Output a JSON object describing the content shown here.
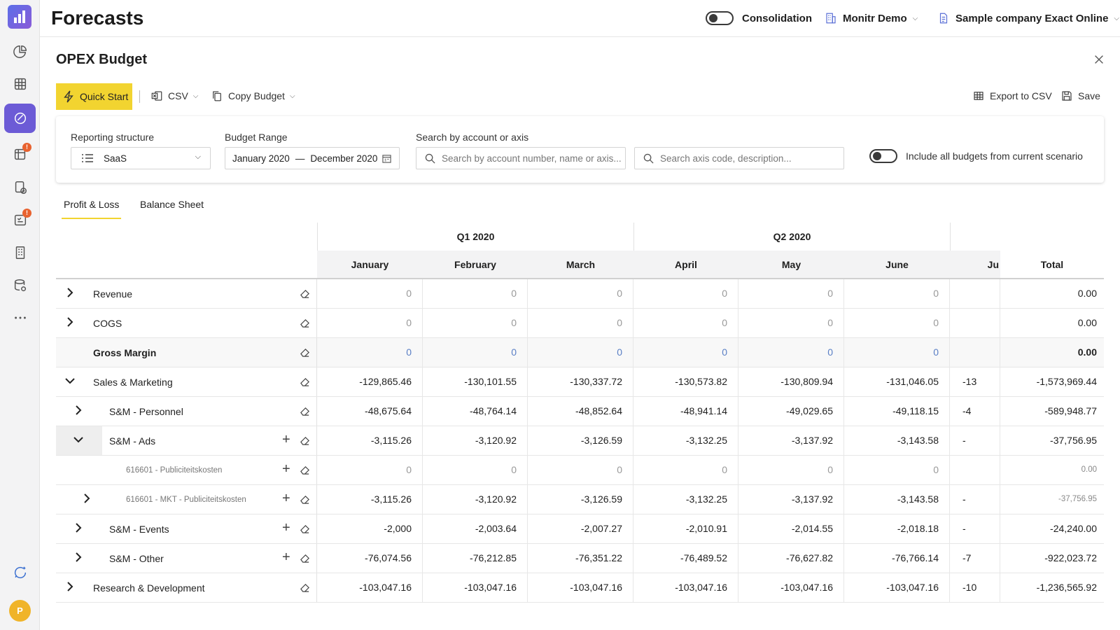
{
  "app": {
    "title": "Forecasts",
    "consolidation_label": "Consolidation",
    "org_name": "Monitr Demo",
    "company_name": "Sample company Exact Online",
    "avatar_initial": "P",
    "badge_count": "!"
  },
  "panel": {
    "title": "OPEX Budget",
    "toolbar": {
      "quick_start": "Quick Start",
      "csv": "CSV",
      "copy_budget": "Copy Budget",
      "export_csv": "Export to CSV",
      "save": "Save"
    },
    "filters": {
      "reporting_label": "Reporting structure",
      "reporting_value": "SaaS",
      "range_label": "Budget Range",
      "range_start": "January 2020",
      "range_sep": "—",
      "range_end": "December 2020",
      "search_label": "Search by account or axis",
      "search_account_placeholder": "Search by account number, name or axis...",
      "search_axis_placeholder": "Search axis code, description...",
      "include_label": "Include all budgets from current scenario"
    },
    "tabs": [
      "Profit & Loss",
      "Balance Sheet"
    ]
  },
  "grid": {
    "quarters": [
      "Q1 2020",
      "Q2 2020"
    ],
    "months": [
      "January",
      "February",
      "March",
      "April",
      "May",
      "June",
      "Ju"
    ],
    "total_label": "Total",
    "rows": [
      {
        "label": "Revenue",
        "values": [
          "0",
          "0",
          "0",
          "0",
          "0",
          "0"
        ],
        "partial": "",
        "total": "0.00"
      },
      {
        "label": "COGS",
        "values": [
          "0",
          "0",
          "0",
          "0",
          "0",
          "0"
        ],
        "partial": "",
        "total": "0.00"
      },
      {
        "label": "Gross Margin",
        "values": [
          "0",
          "0",
          "0",
          "0",
          "0",
          "0"
        ],
        "partial": "",
        "total": "0.00"
      },
      {
        "label": "Sales & Marketing",
        "values": [
          "-129,865.46",
          "-130,101.55",
          "-130,337.72",
          "-130,573.82",
          "-130,809.94",
          "-131,046.05"
        ],
        "partial": "-13",
        "total": "-1,573,969.44"
      },
      {
        "label": "S&M - Personnel",
        "values": [
          "-48,675.64",
          "-48,764.14",
          "-48,852.64",
          "-48,941.14",
          "-49,029.65",
          "-49,118.15"
        ],
        "partial": "-4",
        "total": "-589,948.77"
      },
      {
        "label": "S&M - Ads",
        "values": [
          "-3,115.26",
          "-3,120.92",
          "-3,126.59",
          "-3,132.25",
          "-3,137.92",
          "-3,143.58"
        ],
        "partial": "-",
        "total": "-37,756.95"
      },
      {
        "label": "616601 - Publiciteitskosten",
        "values": [
          "0",
          "0",
          "0",
          "0",
          "0",
          "0"
        ],
        "partial": "",
        "total": "0.00"
      },
      {
        "label": "616601 - MKT - Publiciteitskosten",
        "values": [
          "-3,115.26",
          "-3,120.92",
          "-3,126.59",
          "-3,132.25",
          "-3,137.92",
          "-3,143.58"
        ],
        "partial": "-",
        "total": "-37,756.95"
      },
      {
        "label": "S&M - Events",
        "values": [
          "-2,000",
          "-2,003.64",
          "-2,007.27",
          "-2,010.91",
          "-2,014.55",
          "-2,018.18"
        ],
        "partial": "-",
        "total": "-24,240.00"
      },
      {
        "label": "S&M - Other",
        "values": [
          "-76,074.56",
          "-76,212.85",
          "-76,351.22",
          "-76,489.52",
          "-76,627.82",
          "-76,766.14"
        ],
        "partial": "-7",
        "total": "-922,023.72"
      },
      {
        "label": "Research & Development",
        "values": [
          "-103,047.16",
          "-103,047.16",
          "-103,047.16",
          "-103,047.16",
          "-103,047.16",
          "-103,047.16"
        ],
        "partial": "-10",
        "total": "-1,236,565.92"
      }
    ]
  },
  "colors": {
    "accent_yellow": "#f2d430",
    "rail_active": "#6c5bd6",
    "badge": "#e8622f",
    "gross_margin_value": "#5a7fc5"
  }
}
